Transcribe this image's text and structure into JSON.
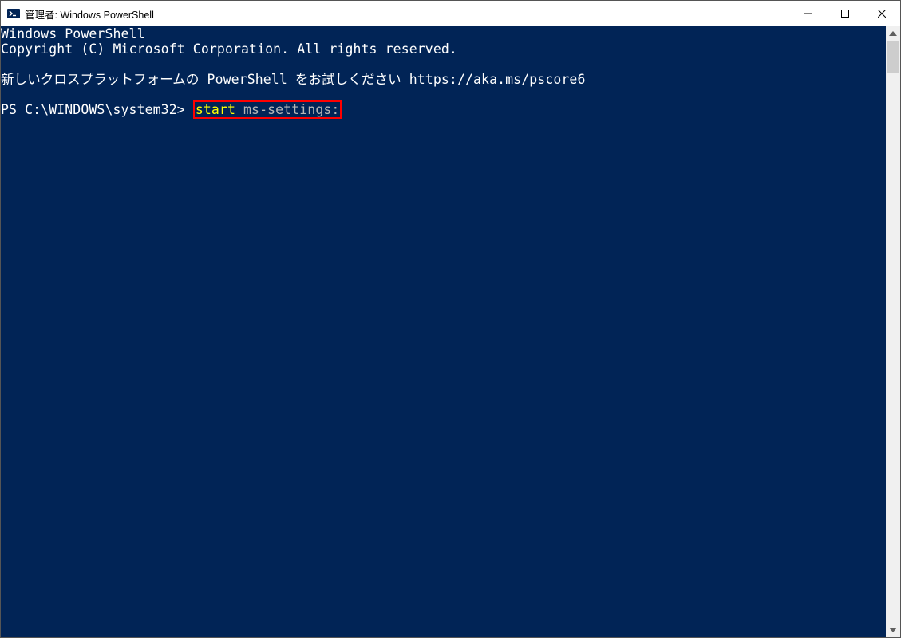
{
  "titlebar": {
    "title": "管理者: Windows PowerShell"
  },
  "terminal": {
    "line1": "Windows PowerShell",
    "line2": "Copyright (C) Microsoft Corporation. All rights reserved.",
    "line3": "新しいクロスプラットフォームの PowerShell をお試しください https://aka.ms/pscore6",
    "prompt": "PS C:\\WINDOWS\\system32> ",
    "command_keyword": "start",
    "command_arg": " ms-settings:"
  }
}
